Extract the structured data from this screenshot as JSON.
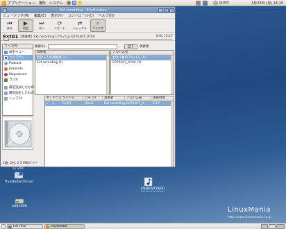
{
  "top_panel": {
    "applications": "アプリケーション",
    "places": "場所",
    "system": "システム",
    "user": "guest",
    "clock": "4月23日 (月) 14:15"
  },
  "window": {
    "title": "Ext recording - Rhythmbox",
    "menu": [
      "ミュージック(M)",
      "編集(E)",
      "表示(V)",
      "コントロール(C)",
      "ヘルプ(H)"
    ],
    "toolbar": {
      "prev": "戻る",
      "play": "再生",
      "next": "次へ",
      "repeat": "リピート",
      "shuffle": "シャッフル",
      "browse": "ブラウザ"
    },
    "now_playing": {
      "title": "Ext01",
      "by": "[演奏者]",
      "artist_album": "Ext recording [アルバム] E070307_0704",
      "time": "0:0s / 2:17"
    },
    "sources_header": "ソース(S)",
    "sources": [
      {
        "label": "再生キュー",
        "color": "#6b8fc0"
      },
      {
        "label": "ライブラリ",
        "color": "#3e6fb8"
      },
      {
        "label": "Podcast",
        "color": "#7ea2d0"
      },
      {
        "label": "Jamendo",
        "color": "#d06a2e"
      },
      {
        "label": "Magnatune",
        "color": "#9a3d8a"
      },
      {
        "label": "ラジオ",
        "color": "#5e7f3b"
      },
      {
        "label": "最近追加したもの",
        "color": "#8ba5c8"
      },
      {
        "label": "最近再生したもの",
        "color": "#8ba5c8"
      },
      {
        "label": "トップ10",
        "color": "#8ba5c8"
      }
    ],
    "search": {
      "label": "検索(E):",
      "all_button": "全て",
      "artist_label": "演奏者"
    },
    "artists_header": "演奏者",
    "artists": [
      "合計 1人の演奏者 (1)",
      "Ext recording (1)"
    ],
    "albums_header": "アルバム名",
    "albums": [
      "合計 1枚のアルバム (1)",
      "E070307_0704 (1)"
    ],
    "tracks_columns": [
      "#",
      "トラック",
      "タイトル",
      "ジャンル",
      "演奏者",
      "アルバム名",
      "演奏時間"
    ],
    "tracks": [
      [
        "▸",
        "1",
        "Ext01",
        "Other",
        "Ext recording",
        "E070307_0...",
        "2:17"
      ]
    ],
    "status": "1曲, 2分, 2.5 MiBバイト"
  },
  "desktop": {
    "icons": [
      {
        "name": "Thunderbird Email"
      },
      {
        "name": "USB DISK"
      },
      {
        "name": "mobi-a2.mp3"
      }
    ],
    "brand": "LinuxMania",
    "brand_url": "http://www.linuxmania.co.jp",
    "small_label": "1s SIM?"
  },
  "taskbar": [
    {
      "label": "Ext reco"
    },
    {
      "label": "[rhythmbo"
    }
  ]
}
